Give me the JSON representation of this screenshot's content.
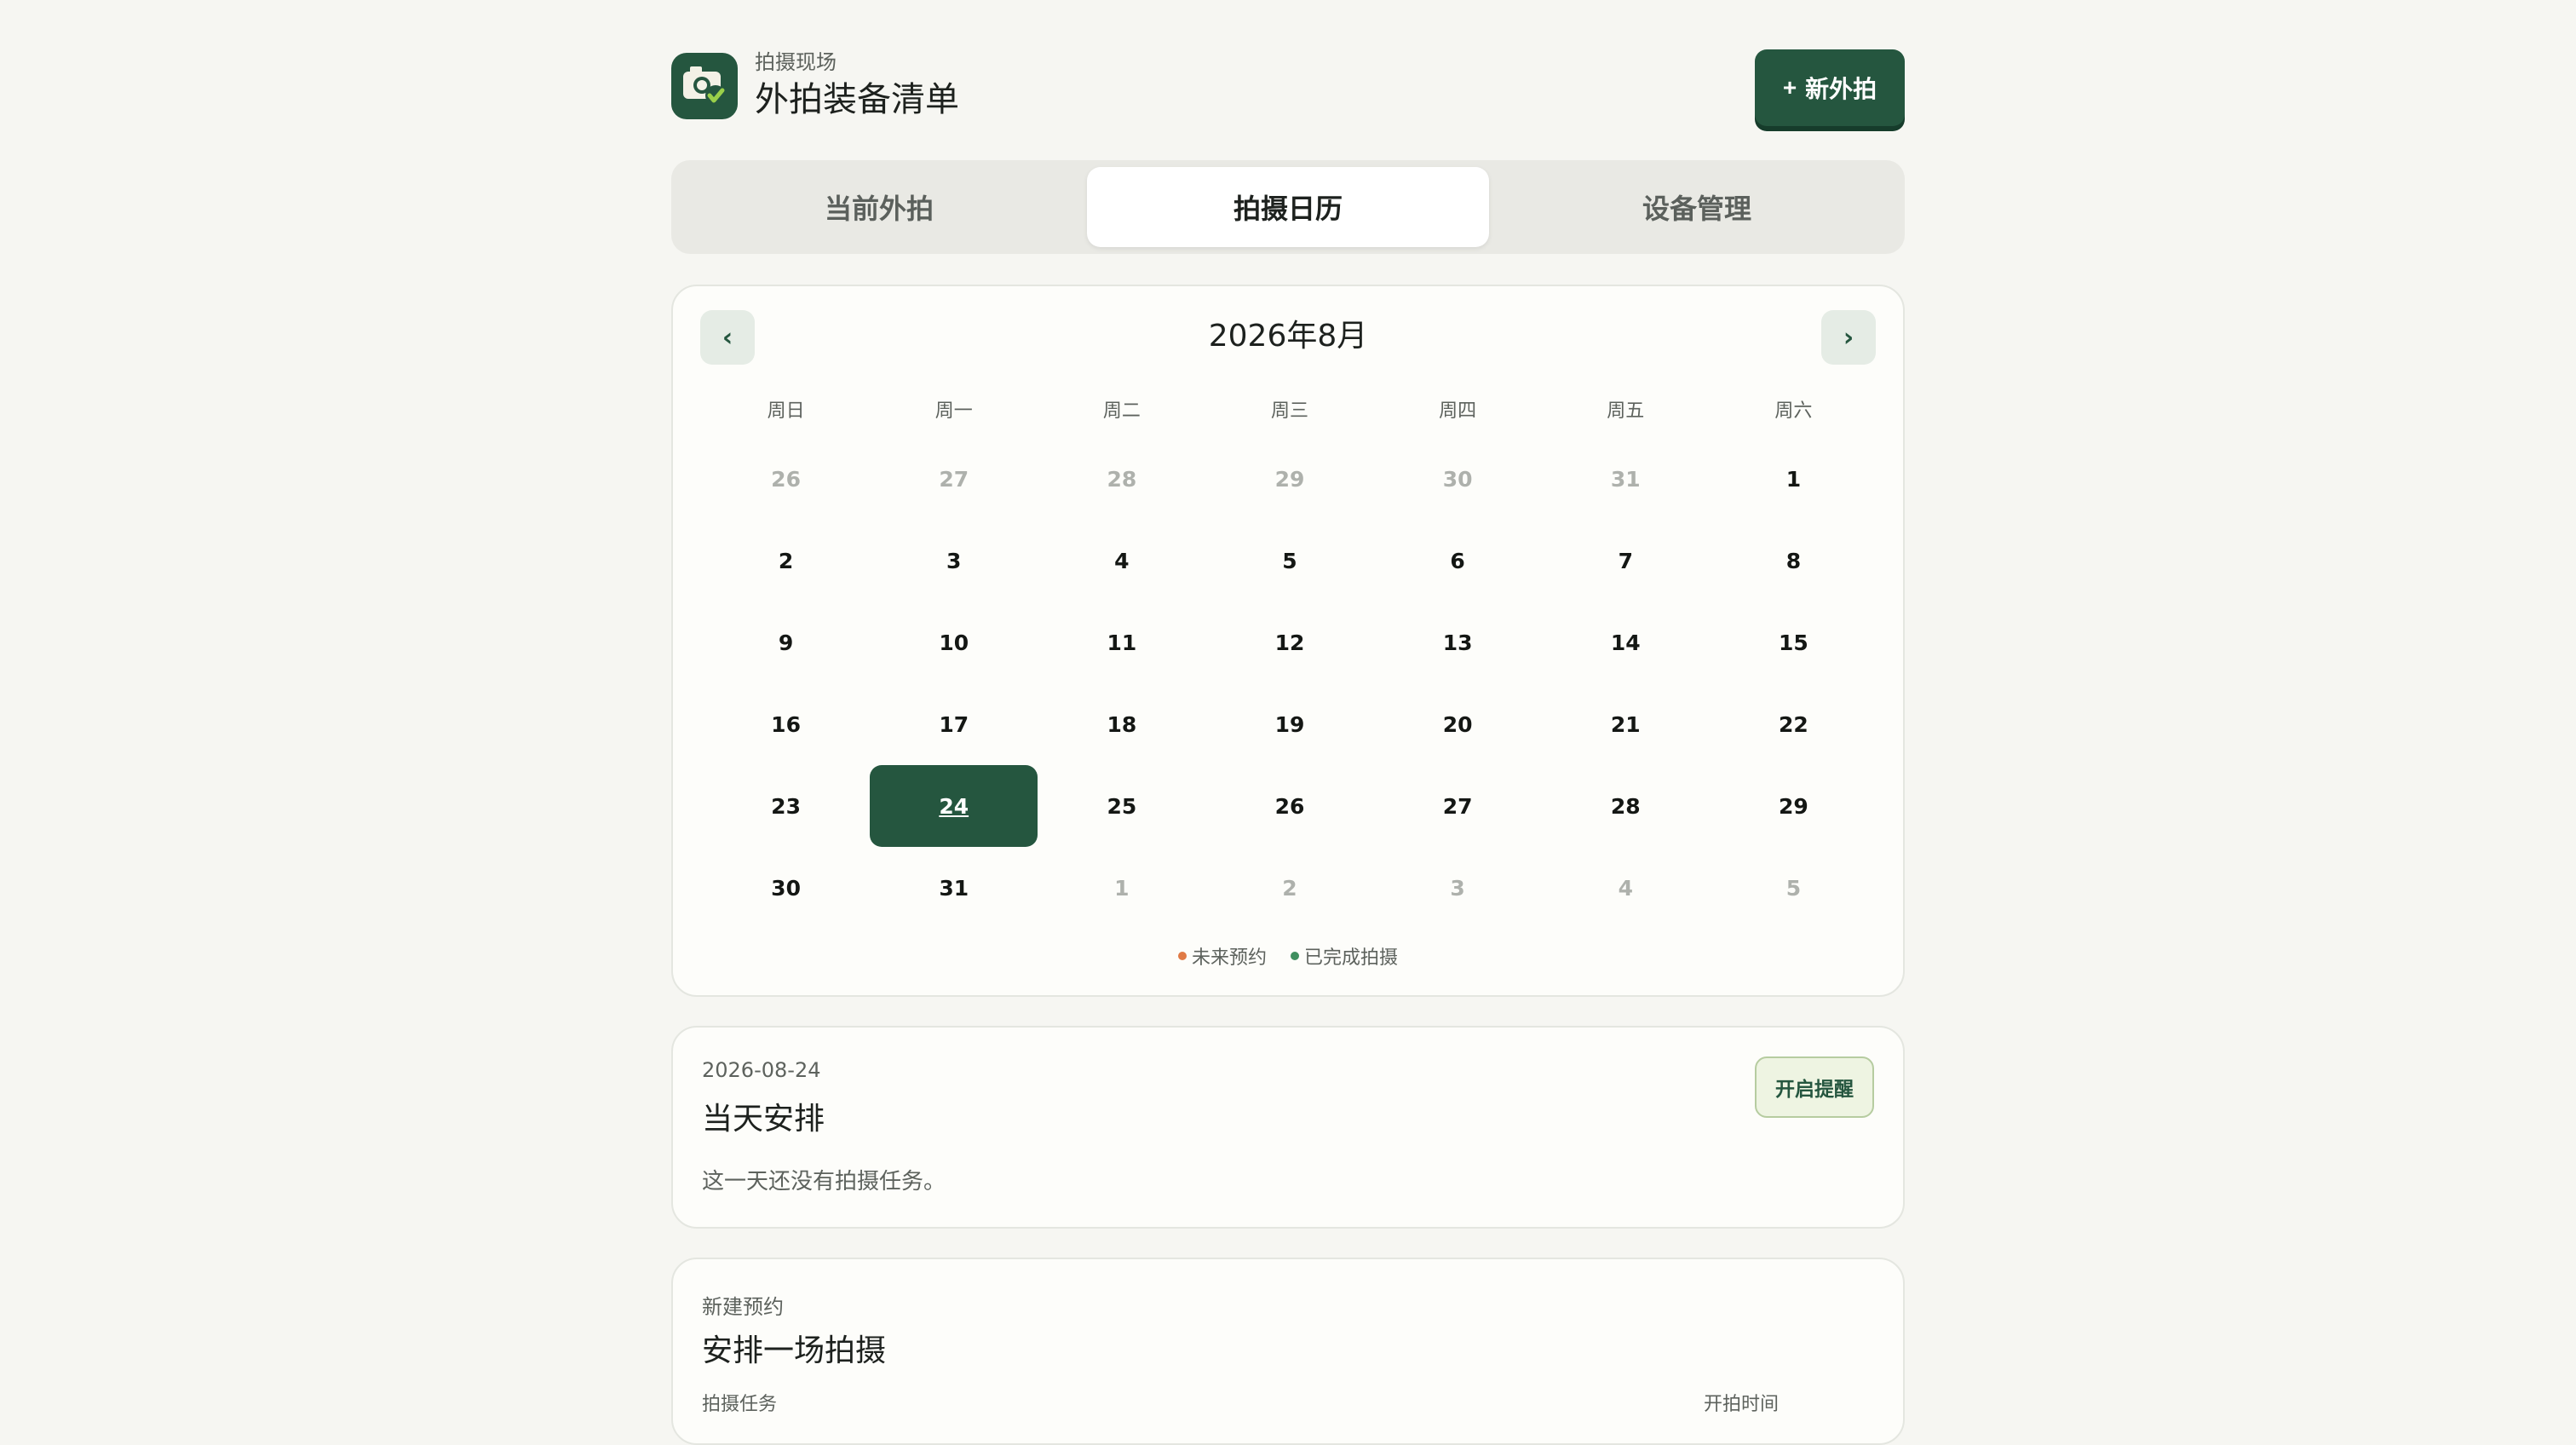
{
  "header": {
    "eyebrow": "拍摄现场",
    "title": "外拍装备清单",
    "new_button": "新外拍",
    "new_button_icon": "plus-icon"
  },
  "tabs": [
    {
      "label": "当前外拍",
      "active": false
    },
    {
      "label": "拍摄日历",
      "active": true
    },
    {
      "label": "设备管理",
      "active": false
    }
  ],
  "calendar": {
    "month_label": "2026年8月",
    "prev": "‹",
    "next": "›",
    "weekdays": [
      "周日",
      "周一",
      "周二",
      "周三",
      "周四",
      "周五",
      "周六"
    ],
    "days": [
      {
        "n": "26",
        "muted": true
      },
      {
        "n": "27",
        "muted": true
      },
      {
        "n": "28",
        "muted": true
      },
      {
        "n": "29",
        "muted": true
      },
      {
        "n": "30",
        "muted": true
      },
      {
        "n": "31",
        "muted": true
      },
      {
        "n": "1"
      },
      {
        "n": "2"
      },
      {
        "n": "3"
      },
      {
        "n": "4"
      },
      {
        "n": "5"
      },
      {
        "n": "6"
      },
      {
        "n": "7"
      },
      {
        "n": "8"
      },
      {
        "n": "9"
      },
      {
        "n": "10"
      },
      {
        "n": "11"
      },
      {
        "n": "12"
      },
      {
        "n": "13"
      },
      {
        "n": "14"
      },
      {
        "n": "15"
      },
      {
        "n": "16"
      },
      {
        "n": "17"
      },
      {
        "n": "18"
      },
      {
        "n": "19"
      },
      {
        "n": "20"
      },
      {
        "n": "21"
      },
      {
        "n": "22"
      },
      {
        "n": "23"
      },
      {
        "n": "24",
        "selected": true
      },
      {
        "n": "25"
      },
      {
        "n": "26"
      },
      {
        "n": "27"
      },
      {
        "n": "28"
      },
      {
        "n": "29"
      },
      {
        "n": "30"
      },
      {
        "n": "31"
      },
      {
        "n": "1",
        "muted": true
      },
      {
        "n": "2",
        "muted": true
      },
      {
        "n": "3",
        "muted": true
      },
      {
        "n": "4",
        "muted": true
      },
      {
        "n": "5",
        "muted": true
      }
    ],
    "legend": [
      {
        "label": "未来预约",
        "color": "#e07a45"
      },
      {
        "label": "已完成拍摄",
        "color": "#3f8f5f"
      }
    ]
  },
  "day_panel": {
    "date": "2026-08-24",
    "title": "当天安排",
    "empty_text": "这一天还没有拍摄任务。",
    "remind_button": "开启提醒"
  },
  "booking": {
    "eyebrow": "新建预约",
    "title": "安排一场拍摄",
    "field_left": "拍摄任务",
    "field_right": "开拍时间"
  },
  "colors": {
    "accent": "#25563f",
    "background": "#f6f6f2"
  }
}
